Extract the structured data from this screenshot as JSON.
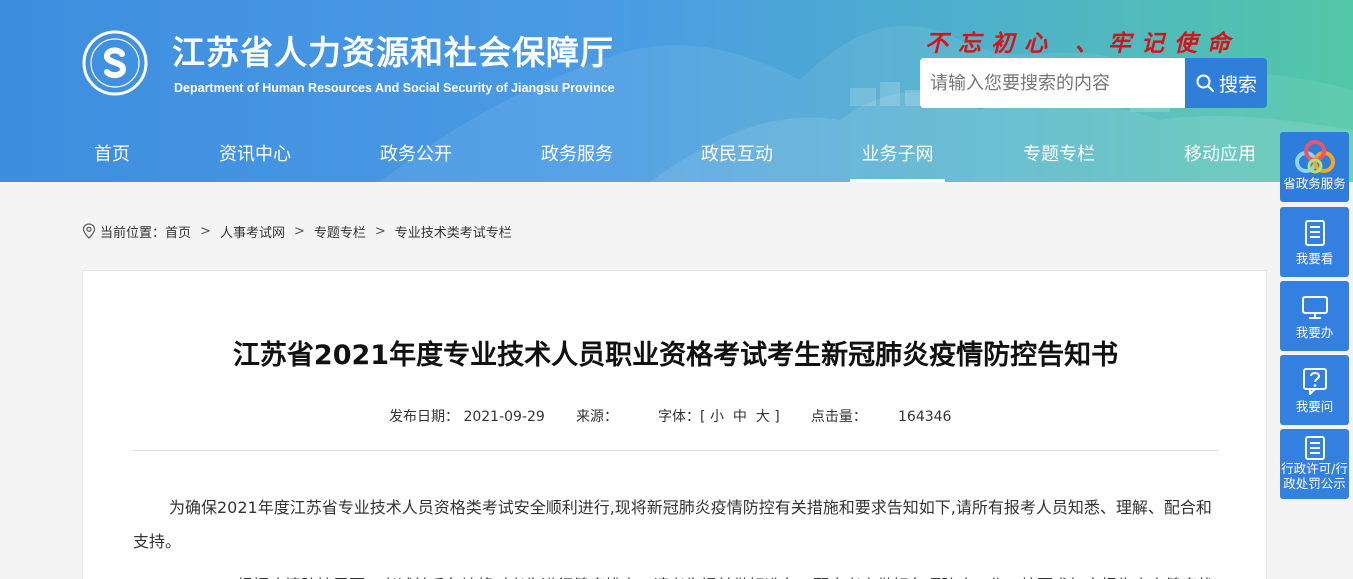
{
  "header": {
    "title": "江苏省人力资源和社会保障厅",
    "subtitle": "Department of Human Resources And Social Security of Jiangsu Province",
    "slogan": "不忘初心 、牢记使命",
    "search_placeholder": "请输入您要搜索的内容",
    "search_button": "搜索"
  },
  "nav": {
    "items": [
      {
        "label": "首页"
      },
      {
        "label": "资讯中心"
      },
      {
        "label": "政务公开"
      },
      {
        "label": "政务服务"
      },
      {
        "label": "政民互动"
      },
      {
        "label": "业务子网"
      },
      {
        "label": "专题专栏"
      },
      {
        "label": "移动应用"
      }
    ],
    "active": "业务子网"
  },
  "breadcrumb": {
    "prefix": "当前位置：",
    "items": [
      "首页",
      "人事考试网",
      "专题专栏",
      "专业技术类考试专栏"
    ],
    "separator": ">"
  },
  "article": {
    "title": "江苏省2021年度专业技术人员职业资格考试考生新冠肺炎疫情防控告知书",
    "meta": {
      "date_label": "发布日期：",
      "date": "2021-09-29",
      "source_label": "来源：",
      "font_label": "字体：[",
      "font_small": "小",
      "font_medium": "中",
      "font_large": "大",
      "font_close": "]",
      "clicks_label": "点击量：",
      "clicks": "164346"
    },
    "paragraph1": "为确保2021年度江苏省专业技术人员资格类考试安全顺利进行,现将新冠肺炎疫情防控有关措施和要求告知如下,请所有报考人员知悉、理解、配合和支持。",
    "paragraph2": "一、根据疫情防控需要，考试前后各地将对考生进行健康排查，请考生提前做好准备，配合考点做好各项防疫工作，按要求如实报告个人健康状况。"
  },
  "side": {
    "items": [
      {
        "label": "省政务服务",
        "icon": "gov-service-logo-icon"
      },
      {
        "label": "我要看",
        "icon": "document-icon"
      },
      {
        "label": "我要办",
        "icon": "monitor-icon"
      },
      {
        "label": "我要问",
        "icon": "question-icon"
      },
      {
        "label": "行政许可/行政处罚公示",
        "label_line1": "行政许可/行",
        "label_line2": "政处罚公示",
        "icon": "list-icon"
      }
    ]
  },
  "colors": {
    "header_start": "#3e8ee0",
    "header_end": "#52c7a6",
    "slogan": "#d8121a",
    "search_button": "#2f7fd8",
    "side_button": "#3480e0"
  }
}
